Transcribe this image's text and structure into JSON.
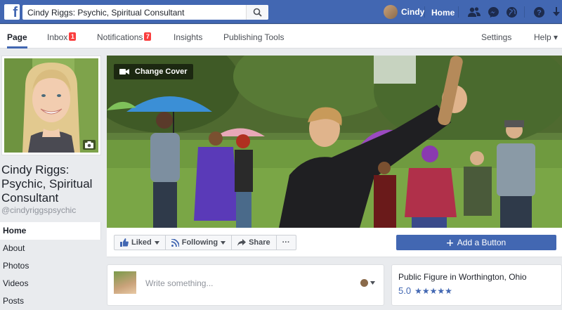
{
  "topbar": {
    "logo": "f",
    "search_value": "Cindy Riggs: Psychic, Spiritual Consultant",
    "user_name": "Cindy",
    "home_label": "Home",
    "icons": [
      "friends-icon",
      "messenger-icon",
      "globe-icon",
      "help-icon",
      "caret-down-icon"
    ]
  },
  "pagenav": {
    "page_label": "Page",
    "inbox_label": "Inbox",
    "inbox_count": "1",
    "notifications_label": "Notifications",
    "notifications_count": "7",
    "insights_label": "Insights",
    "publishing_label": "Publishing Tools",
    "settings_label": "Settings",
    "help_label": "Help ▾"
  },
  "profile": {
    "name": "Cindy Riggs: Psychic, Spiritual Consultant",
    "handle": "@cindyriggspsychic"
  },
  "sidebar": {
    "items": [
      {
        "label": "Home"
      },
      {
        "label": "About"
      },
      {
        "label": "Photos"
      },
      {
        "label": "Videos"
      },
      {
        "label": "Posts"
      }
    ]
  },
  "cover": {
    "change_cover_label": "Change Cover"
  },
  "actions": {
    "liked_label": "Liked",
    "following_label": "Following",
    "share_label": "Share",
    "more_label": "···",
    "add_button_label": "Add a Button"
  },
  "composer": {
    "placeholder": "Write something..."
  },
  "about": {
    "category": "Public Figure in Worthington, Ohio",
    "rating": "5.0",
    "stars": "★★★★★"
  },
  "colors": {
    "brand_blue": "#4267b2",
    "badge_red": "#fa3e3e"
  }
}
